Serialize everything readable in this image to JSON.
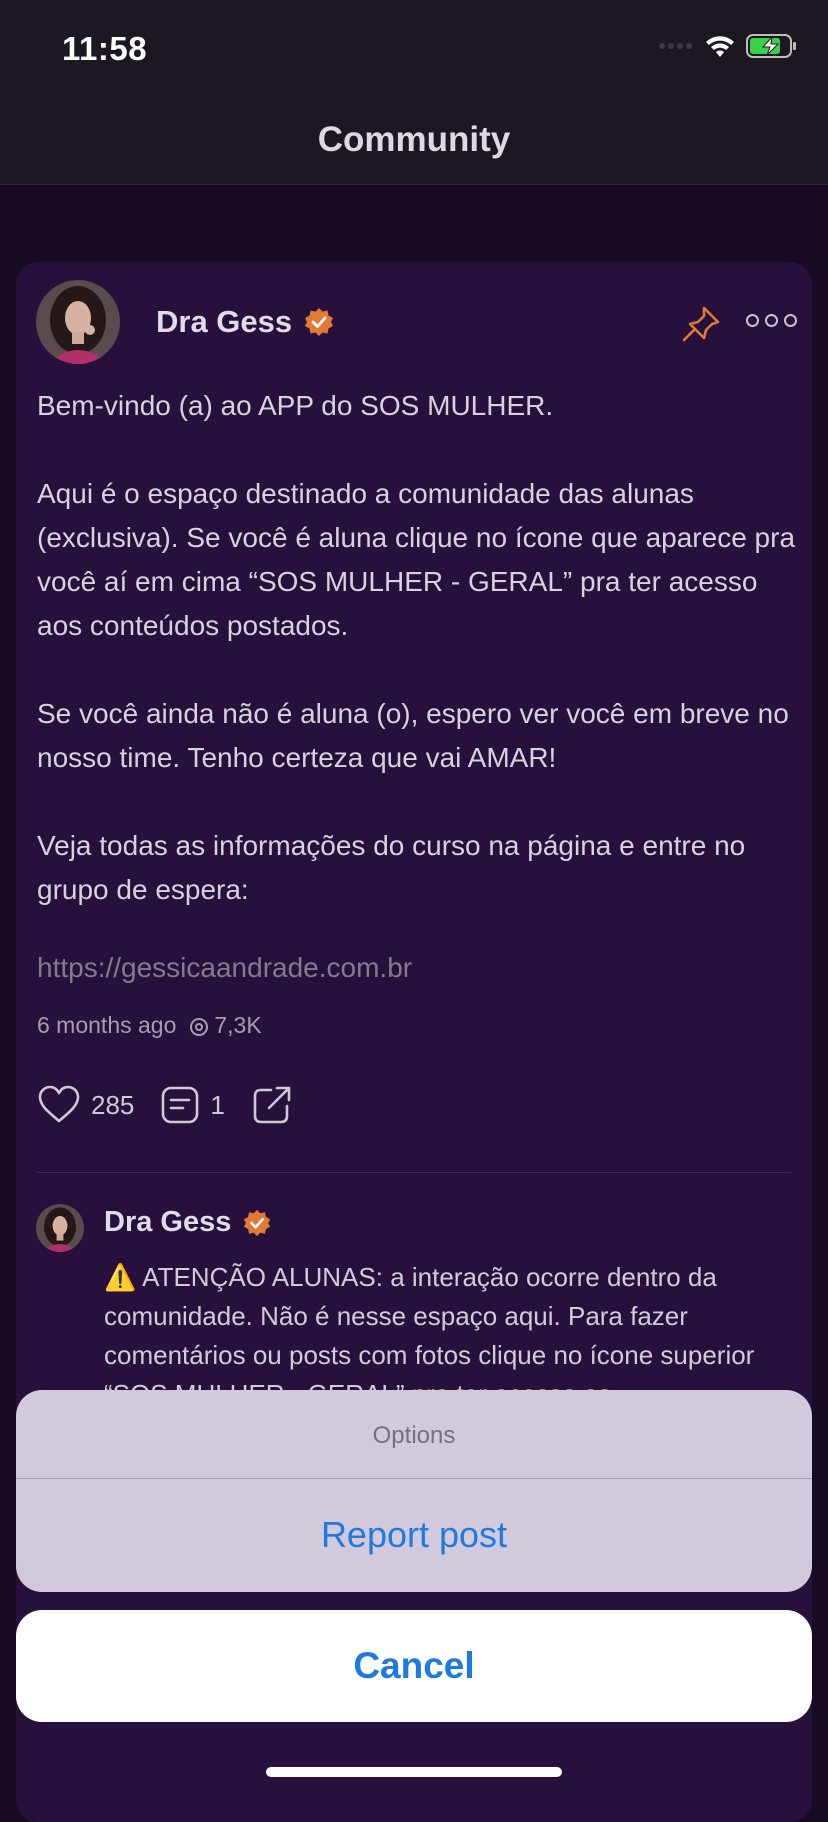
{
  "status": {
    "time": "11:58"
  },
  "nav": {
    "title": "Community"
  },
  "post": {
    "author": "Dra Gess",
    "paragraphs": [
      "Bem-vindo (a) ao APP do SOS MULHER.",
      "Aqui é o espaço destinado a comunidade das alunas (exclusiva). Se você é aluna clique no ícone que aparece pra você aí em cima “SOS MULHER - GERAL” pra ter acesso aos conteúdos postados.",
      "Se você ainda não é aluna (o), espero ver você em breve no nosso time. Tenho certeza que vai AMAR!",
      "Veja todas as informações do curso na página e entre no grupo de espera:"
    ],
    "link": "https://gessicaandrade.com.br",
    "time_ago": "6 months ago",
    "views": "7,3K",
    "likes": "285",
    "comments": "1"
  },
  "comment": {
    "author": "Dra Gess",
    "text": "⚠️ ATENÇÃO ALUNAS: a interação ocorre dentro da comunidade. Não é nesse espaço aqui. Para fazer comentários ou posts com fotos clique no ícone superior “SOS MULHER - GERAL” pra ter acesso as"
  },
  "sheet": {
    "title": "Options",
    "report_label": "Report post",
    "cancel_label": "Cancel"
  },
  "colors": {
    "accent": "#1f7ae0",
    "badge": "#e07a36",
    "card": "#27113c",
    "background": "#170b23"
  }
}
